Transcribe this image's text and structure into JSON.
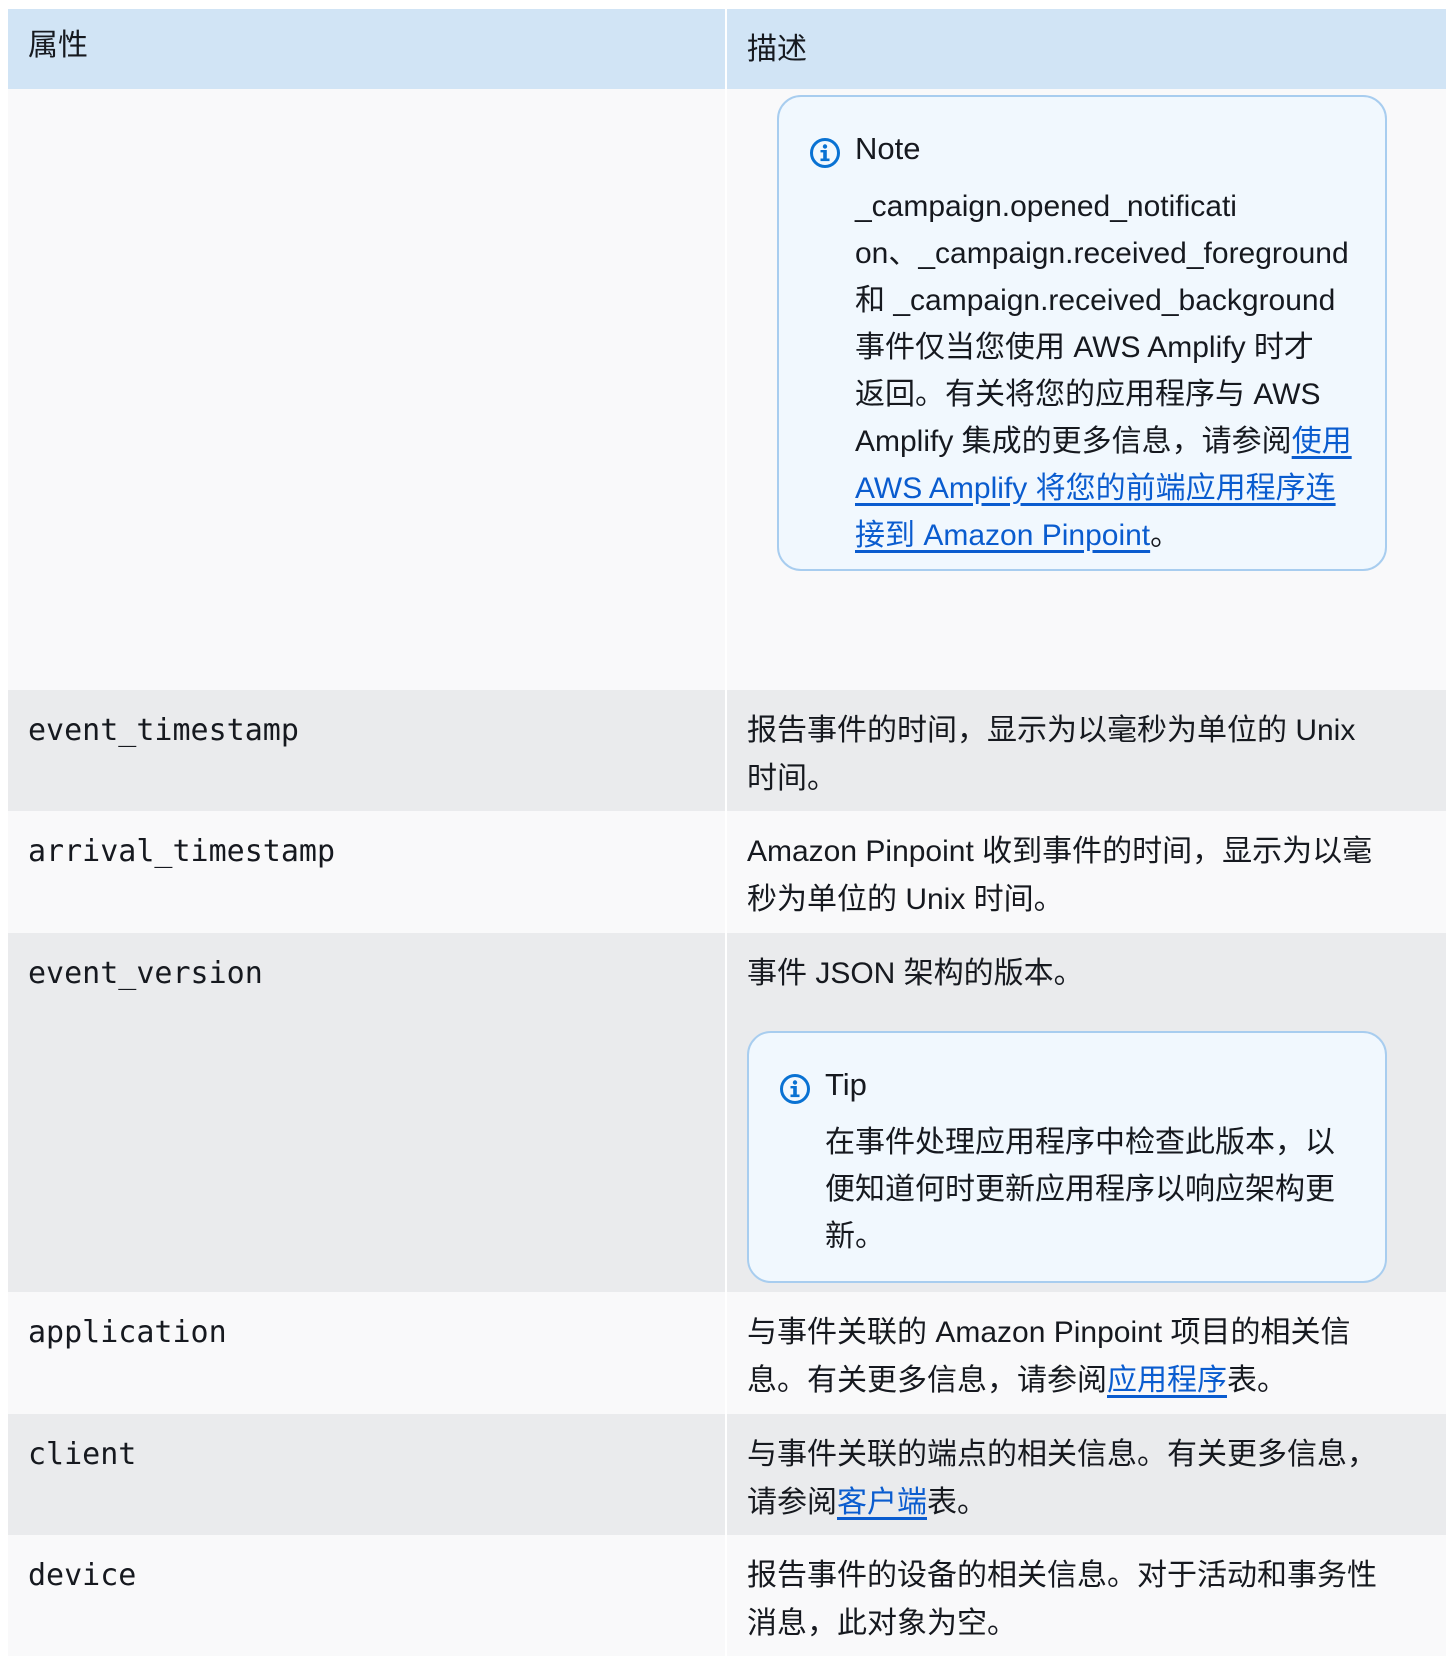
{
  "table": {
    "headers": {
      "property": "属性",
      "description": "描述"
    },
    "note": {
      "title": "Note",
      "lines": [
        "_campaign.opened_notificati",
        "on、_campaign.received_foreground",
        "和 _campaign.received_background",
        "事件仅当您使用 AWS Amplify 时才",
        "返回。有关将您的应用程序与 AWS",
        "Amplify 集成的更多信息，请参阅"
      ],
      "link_lines": [
        "使用",
        "AWS Amplify 将您的前端应用程序连",
        "接到 Amazon Pinpoint"
      ],
      "end": "。"
    },
    "rows": [
      {
        "property": "event_timestamp",
        "desc_lines": [
          "报告事件的时间，显示为以毫秒为单位的 Unix",
          "时间。"
        ]
      },
      {
        "property": "arrival_timestamp",
        "desc_lines": [
          "Amazon Pinpoint 收到事件的时间，显示为以毫",
          "秒为单位的 Unix 时间。"
        ]
      },
      {
        "property": "event_version",
        "desc_lines": [
          "事件 JSON 架构的版本。"
        ],
        "tip": {
          "title": "Tip",
          "lines": [
            "在事件处理应用程序中检查此版本，以",
            "便知道何时更新应用程序以响应架构更",
            "新。"
          ]
        }
      },
      {
        "property": "application",
        "desc_line1": "与事件关联的 Amazon Pinpoint 项目的相关信",
        "desc_pre": "息。有关更多信息，请参阅",
        "desc_link": "应用程序",
        "desc_post": "表。"
      },
      {
        "property": "client",
        "desc_line1": "与事件关联的端点的相关信息。有关更多信息，",
        "desc_pre": "请参阅",
        "desc_link": "客户端",
        "desc_post": "表。"
      },
      {
        "property": "device",
        "desc_lines": [
          "报告事件的设备的相关信息。对于活动和事务性",
          "消息，此对象为空。"
        ]
      }
    ]
  },
  "colors": {
    "header_bg": "#d1e4f5",
    "row_alt_bg": "#eaebed",
    "row_bg": "#f9f9fa",
    "link": "#0a5ccf",
    "callout_border": "#a8cdef",
    "callout_bg": "#f1f8fe",
    "icon": "#0972d3"
  },
  "icons": {
    "note": "info-icon",
    "tip": "info-icon"
  }
}
